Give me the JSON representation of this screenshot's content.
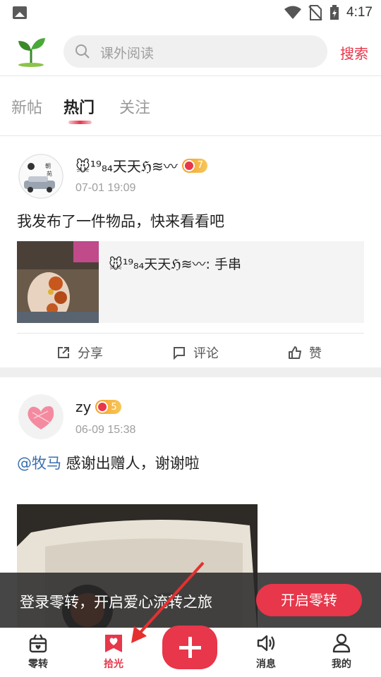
{
  "status_bar": {
    "time": "4:17"
  },
  "header": {
    "search_placeholder": "课外阅读",
    "search_button": "搜索"
  },
  "tabs": [
    {
      "label": "新帖",
      "active": false
    },
    {
      "label": "热门",
      "active": true
    },
    {
      "label": "关注",
      "active": false
    }
  ],
  "posts": [
    {
      "username": "🐭¹⁹₈₄天天ℌ≋〰",
      "level": "7",
      "time": "07-01 19:09",
      "content": "我发布了一件物品，快来看看吧",
      "card_text": "🐭¹⁹₈₄天天ℌ≋〰:  手串",
      "actions": {
        "share": "分享",
        "comment": "评论",
        "like": "赞"
      }
    },
    {
      "username": "zy",
      "level": "5",
      "time": "06-09 15:38",
      "mention": "@牧马",
      "content": " 感谢出赠人，谢谢啦"
    }
  ],
  "banner": {
    "text": "登录零转，开启爱心流转之旅",
    "button": "开启零转"
  },
  "bottom_nav": [
    {
      "label": "零转",
      "icon": "gift-box-icon",
      "active": false
    },
    {
      "label": "拾光",
      "icon": "heart-flag-icon",
      "active": true
    },
    {
      "label": "",
      "icon": "plus-icon",
      "active": false
    },
    {
      "label": "消息",
      "icon": "speaker-icon",
      "active": false
    },
    {
      "label": "我的",
      "icon": "person-icon",
      "active": false
    }
  ],
  "colors": {
    "accent": "#e8364a",
    "mention": "#3a6fb0",
    "badge": "#f4a02a"
  }
}
